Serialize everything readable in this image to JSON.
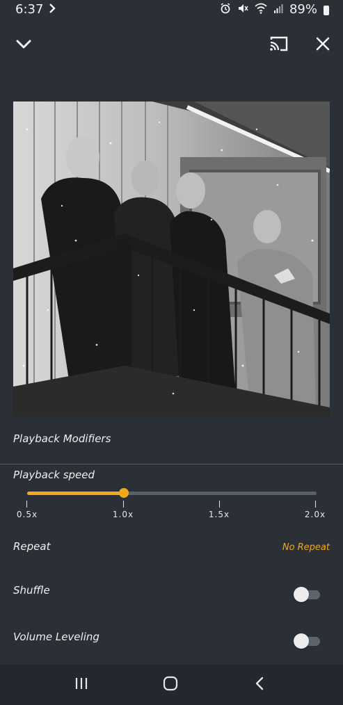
{
  "status_bar": {
    "time": "6:37",
    "battery_percent": "89%",
    "icons": [
      "forward-chevron-icon",
      "alarm-icon",
      "mute-icon",
      "wifi-icon",
      "signal-icon",
      "battery-icon"
    ]
  },
  "header": {
    "icons": [
      "chevron-down-icon",
      "cast-icon",
      "close-icon"
    ]
  },
  "album_art": {
    "description_icon": "album-art-image"
  },
  "modifiers": {
    "title": "Playback Modifiers",
    "speed": {
      "label": "Playback speed",
      "value": 1.0,
      "min": 0.5,
      "max": 2.0,
      "ticks": [
        "0.5x",
        "1.0x",
        "1.5x",
        "2.0x"
      ]
    },
    "repeat": {
      "label": "Repeat",
      "value": "No Repeat"
    },
    "shuffle": {
      "label": "Shuffle",
      "enabled": false
    },
    "volume_leveling": {
      "label": "Volume Leveling",
      "enabled": false
    }
  },
  "colors": {
    "background": "#2b2f36",
    "accent": "#f2a81d",
    "nav_bar": "#24272d"
  },
  "nav_bar": {
    "icons": [
      "recents-icon",
      "home-icon",
      "back-icon"
    ]
  }
}
